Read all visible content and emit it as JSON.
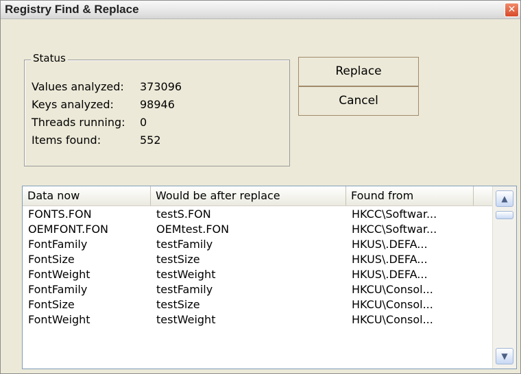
{
  "window": {
    "title": "Registry Find & Replace",
    "close_glyph": "✕"
  },
  "status": {
    "legend": "Status",
    "rows": [
      {
        "key": "Values analyzed:",
        "value": "373096"
      },
      {
        "key": "Keys analyzed:",
        "value": "98946"
      },
      {
        "key": "Threads running:",
        "value": "0"
      },
      {
        "key": "Items found:",
        "value": "552"
      }
    ]
  },
  "buttons": {
    "replace": "Replace",
    "cancel": "Cancel"
  },
  "table": {
    "headers": [
      "Data now",
      "Would be after replace",
      "Found from"
    ],
    "rows": [
      [
        "FONTS.FON",
        "testS.FON",
        "HKCC\\Softwar..."
      ],
      [
        "OEMFONT.FON",
        "OEMtest.FON",
        "HKCC\\Softwar..."
      ],
      [
        "FontFamily",
        "testFamily",
        "HKUS\\.DEFA..."
      ],
      [
        "FontSize",
        "testSize",
        "HKUS\\.DEFA..."
      ],
      [
        "FontWeight",
        "testWeight",
        "HKUS\\.DEFA..."
      ],
      [
        "FontFamily",
        "testFamily",
        "HKCU\\Consol..."
      ],
      [
        "FontSize",
        "testSize",
        "HKCU\\Consol..."
      ],
      [
        "FontWeight",
        "testWeight",
        "HKCU\\Consol..."
      ]
    ]
  },
  "scrollbar": {
    "up_glyph": "▲",
    "down_glyph": "▼"
  },
  "colors": {
    "window_bg": "#ece9d8",
    "close_red": "#d84a2a",
    "list_border": "#7f9db9"
  }
}
